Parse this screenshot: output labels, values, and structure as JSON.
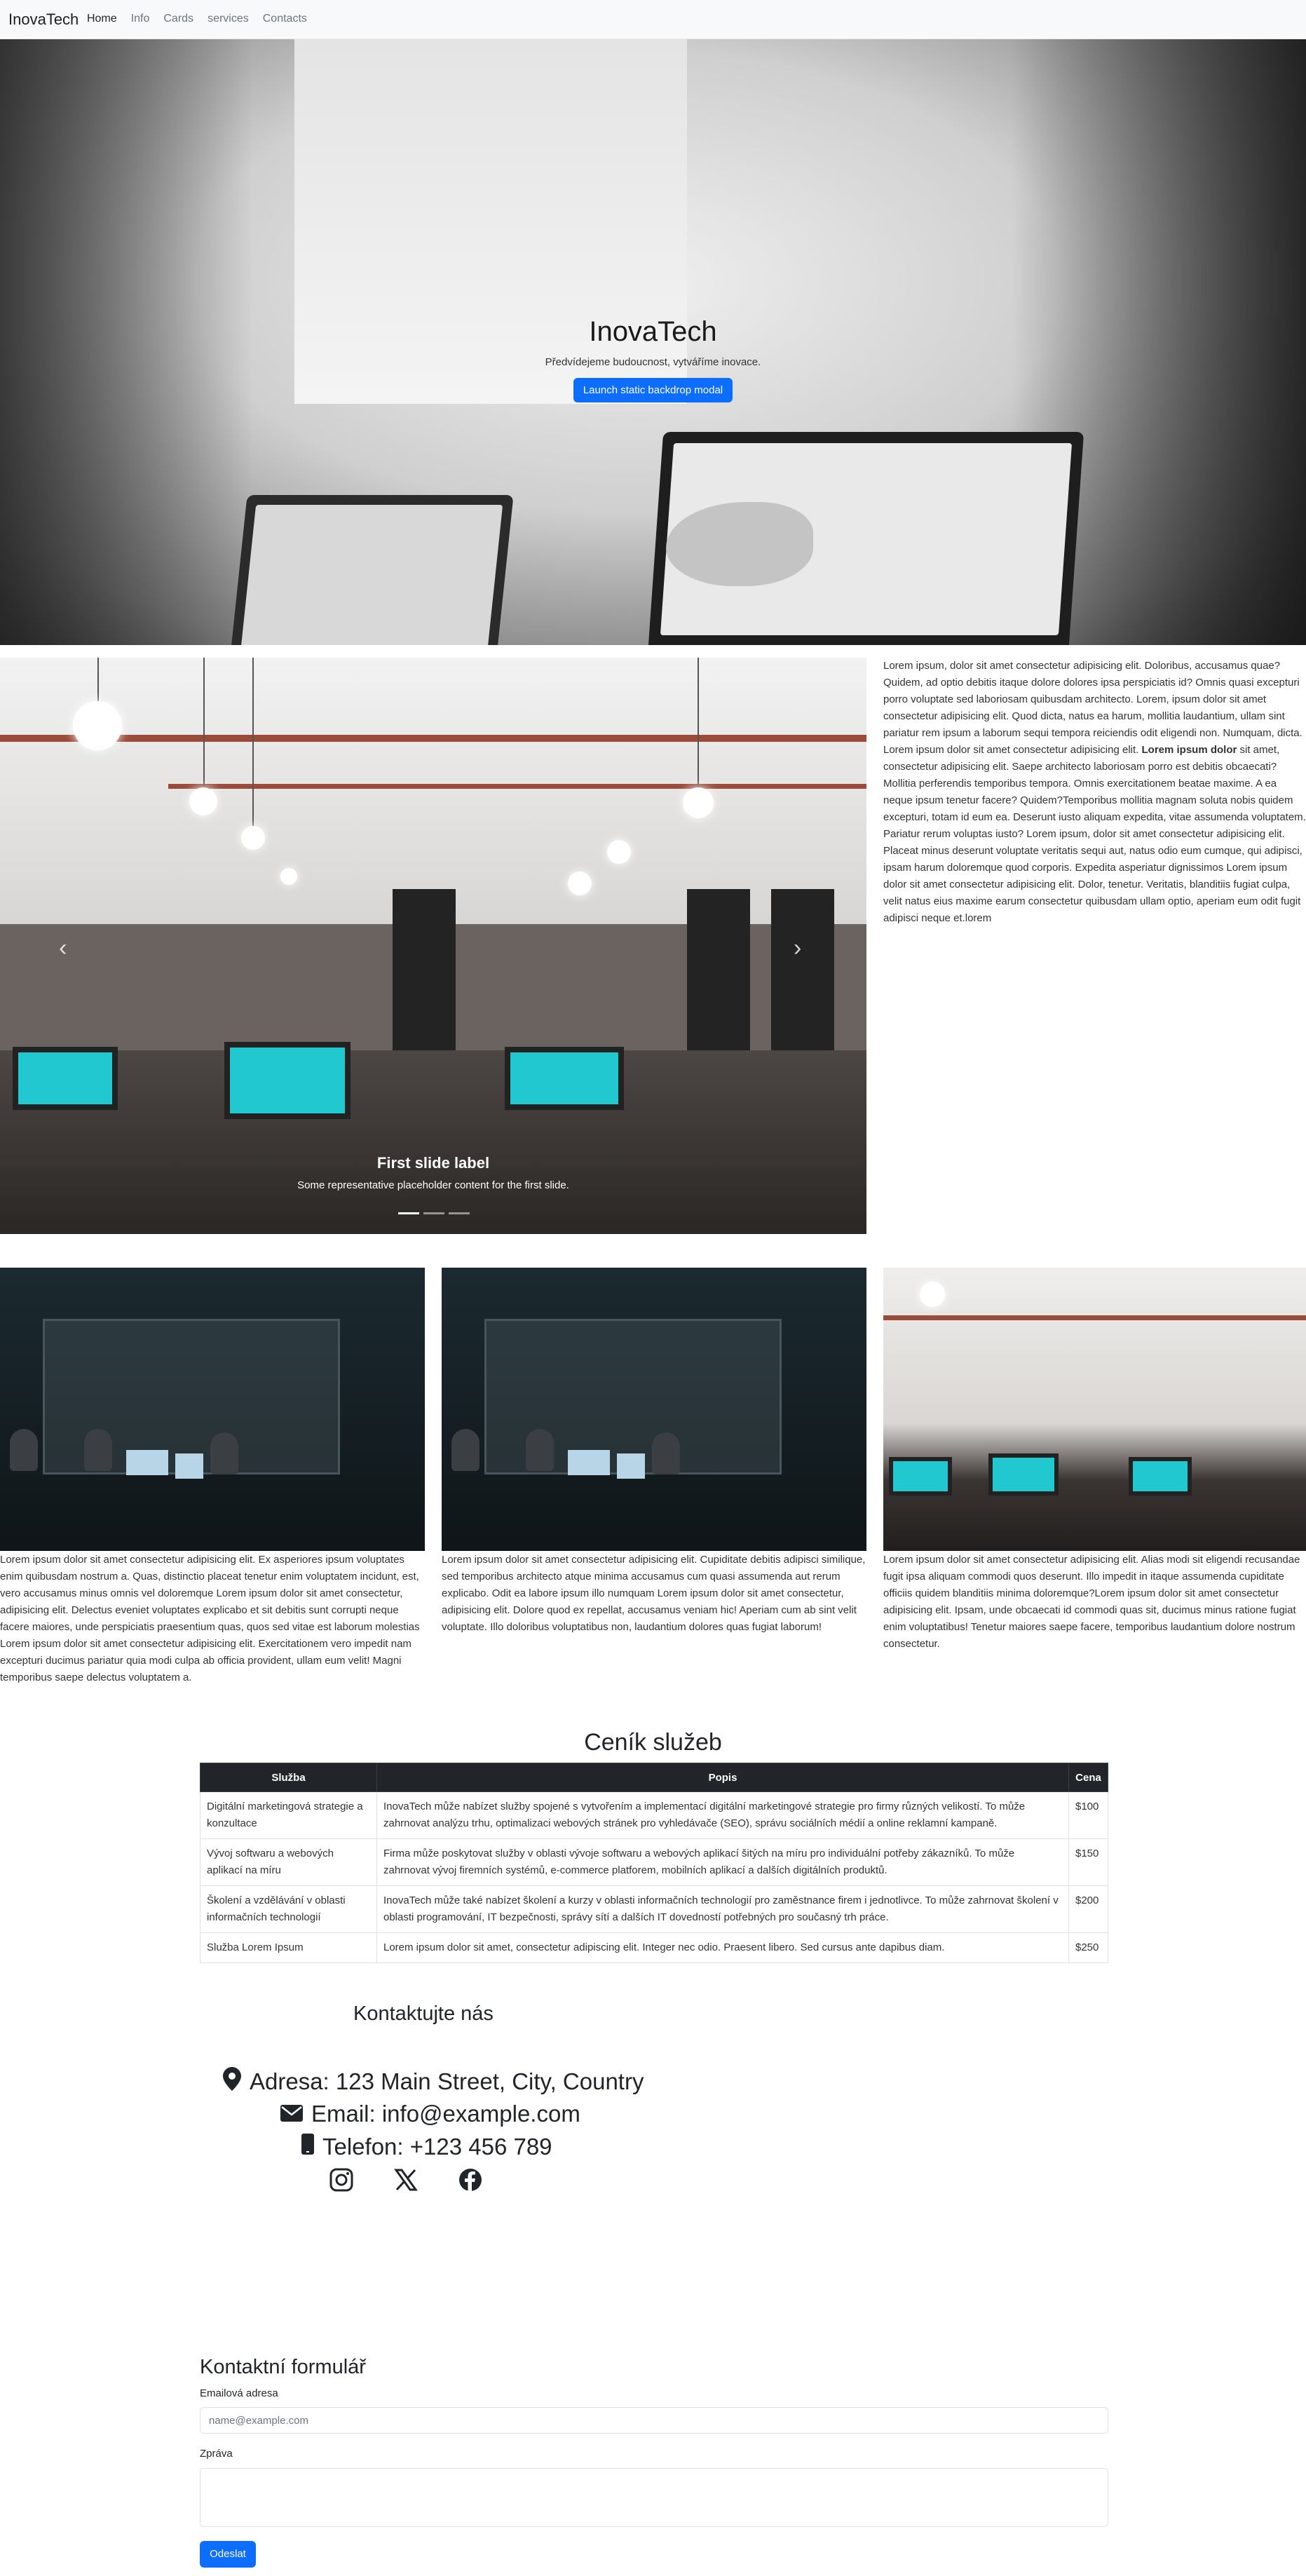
{
  "nav": {
    "brand": "InovaTech",
    "links": [
      "Home",
      "Info",
      "Cards",
      "services",
      "Contacts"
    ]
  },
  "hero": {
    "title": "InovaTech",
    "subtitle": "Předvídejeme budoucnost, vytváříme inovace.",
    "button": "Launch static backdrop modal"
  },
  "carousel": {
    "prev_icon": "chevron-left-icon",
    "next_icon": "chevron-right-icon",
    "label": "First slide label",
    "caption": "Some representative placeholder content for the first slide.",
    "indicator_count": 3,
    "active_index": 0
  },
  "side_text": {
    "before_bold": "Lorem ipsum, dolor sit amet consectetur adipisicing elit. Doloribus, accusamus quae? Quidem, ad optio debitis itaque dolore dolores ipsa perspiciatis id? Omnis quasi excepturi porro voluptate sed laboriosam quibusdam architecto. Lorem, ipsum dolor sit amet consectetur adipisicing elit. Quod dicta, natus ea harum, mollitia laudantium, ullam sint pariatur rem ipsum a laborum sequi tempora reiciendis odit eligendi non. Numquam, dicta. Lorem ipsum dolor sit amet consectetur adipisicing elit. ",
    "bold": "Lorem ipsum dolor",
    "after_bold": " sit amet, consectetur adipisicing elit. Saepe architecto laboriosam porro est debitis obcaecati? Mollitia perferendis temporibus tempora. Omnis exercitationem beatae maxime. A ea neque ipsum tenetur facere? Quidem?Temporibus mollitia magnam soluta nobis quidem excepturi, totam id eum ea. Deserunt iusto aliquam expedita, vitae assumenda voluptatem. Pariatur rerum voluptas iusto? Lorem ipsum, dolor sit amet consectetur adipisicing elit. Placeat minus deserunt voluptate veritatis sequi aut, natus odio eum cumque, qui adipisci, ipsam harum doloremque quod corporis. Expedita asperiatur dignissimos Lorem ipsum dolor sit amet consectetur adipisicing elit. Dolor, tenetur. Veritatis, blanditiis fugiat culpa, velit natus eius maxime earum consectetur quibusdam ullam optio, aperiam eum odit fugit adipisci neque et.lorem"
  },
  "cards": [
    {
      "text": "Lorem ipsum dolor sit amet consectetur adipisicing elit. Ex asperiores ipsum voluptates enim quibusdam nostrum a. Quas, distinctio placeat tenetur enim voluptatem incidunt, est, vero accusamus minus omnis vel doloremque Lorem ipsum dolor sit amet consectetur, adipisicing elit. Delectus eveniet voluptates explicabo et sit debitis sunt corrupti neque facere maiores, unde perspiciatis praesentium quas, quos sed vitae est laborum molestias Lorem ipsum dolor sit amet consectetur adipisicing elit. Exercitationem vero impedit nam excepturi ducimus pariatur quia modi culpa ab officia provident, ullam eum velit! Magni temporibus saepe delectus voluptatem a."
    },
    {
      "text": "Lorem ipsum dolor sit amet consectetur adipisicing elit. Cupiditate debitis adipisci similique, sed temporibus architecto atque minima accusamus cum quasi assumenda aut rerum explicabo. Odit ea labore ipsum illo numquam Lorem ipsum dolor sit amet consectetur, adipisicing elit. Dolore quod ex repellat, accusamus veniam hic! Aperiam cum ab sint velit voluptate. Illo doloribus voluptatibus non, laudantium dolores quas fugiat laborum!"
    },
    {
      "text": "Lorem ipsum dolor sit amet consectetur adipisicing elit. Alias modi sit eligendi recusandae fugit ipsa aliquam commodi quos deserunt. Illo impedit in itaque assumenda cupiditate officiis quidem blanditiis minima doloremque?Lorem ipsum dolor sit amet consectetur adipisicing elit. Ipsam, unde obcaecati id commodi quas sit, ducimus minus ratione fugiat enim voluptatibus! Tenetur maiores saepe facere, temporibus laudantium dolore nostrum consectetur."
    }
  ],
  "pricing": {
    "title": "Ceník služeb",
    "headers": [
      "Služba",
      "Popis",
      "Cena"
    ],
    "rows": [
      {
        "service": "Digitální marketingová strategie a konzultace",
        "desc": "InovaTech může nabízet služby spojené s vytvořením a implementací digitální marketingové strategie pro firmy různých velikostí. To může zahrnovat analýzu trhu, optimalizaci webových stránek pro vyhledávače (SEO), správu sociálních médií a online reklamní kampaně.",
        "price": "$100"
      },
      {
        "service": "Vývoj softwaru a webových aplikací na míru",
        "desc": "Firma může poskytovat služby v oblasti vývoje softwaru a webových aplikací šitých na míru pro individuální potřeby zákazníků. To může zahrnovat vývoj firemních systémů, e-commerce platforem, mobilních aplikací a dalších digitálních produktů.",
        "price": "$150"
      },
      {
        "service": "Školení a vzdělávání v oblasti informačních technologií",
        "desc": "InovaTech může také nabízet školení a kurzy v oblasti informačních technologií pro zaměstnance firem i jednotlivce. To může zahrnovat školení v oblasti programování, IT bezpečnosti, správy sítí a dalších IT dovedností potřebných pro současný trh práce.",
        "price": "$200"
      },
      {
        "service": "Služba Lorem Ipsum",
        "desc": "Lorem ipsum dolor sit amet, consectetur adipiscing elit. Integer nec odio. Praesent libero. Sed cursus ante dapibus diam.",
        "price": "$250"
      }
    ]
  },
  "contact": {
    "title": "Kontaktujte nás",
    "address": "Adresa: 123 Main Street, City, Country",
    "email": "Email: info@example.com",
    "phone": "Telefon: +123 456 789",
    "social_icons": [
      "instagram-icon",
      "x-icon",
      "facebook-icon"
    ]
  },
  "form": {
    "title": "Kontaktní formulář",
    "email_label": "Emailová adresa",
    "email_placeholder": "name@example.com",
    "message_label": "Zpráva",
    "submit": "Odeslat"
  },
  "colors": {
    "primary": "#0d6efd",
    "table_header": "#212529",
    "navbar_bg": "#f8f9fa"
  }
}
